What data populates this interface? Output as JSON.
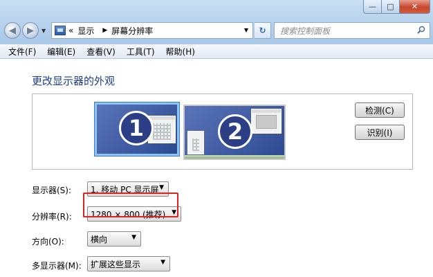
{
  "window": {
    "controls": {
      "minimize": "—",
      "maximize": "□",
      "close": "✕"
    }
  },
  "nav": {
    "back": "◀",
    "forward": "▶",
    "address": {
      "prefix": "«",
      "crumbs": [
        "显示",
        "屏幕分辨率"
      ],
      "separator": "▶"
    },
    "refresh": "↻",
    "search_placeholder": "搜索控制面板"
  },
  "menu": {
    "items": [
      "文件(F)",
      "编辑(E)",
      "查看(V)",
      "工具(T)",
      "帮助(H)"
    ]
  },
  "main": {
    "heading": "更改显示器的外观",
    "monitors": [
      {
        "number": "1",
        "selected": true
      },
      {
        "number": "2",
        "selected": false
      }
    ],
    "detect_button": "检测(C)",
    "identify_button": "识别(I)",
    "fields": {
      "display": {
        "label": "显示器(S):",
        "value": "1. 移动 PC 显示屏"
      },
      "resolution": {
        "label": "分辨率(R):",
        "value": "1280 × 800 (推荐)"
      },
      "orientation": {
        "label": "方向(O):",
        "value": "横向"
      },
      "multi_display": {
        "label": "多显示器(M):",
        "value": "扩展这些显示"
      }
    }
  },
  "colors": {
    "heading": "#1e3c8c",
    "highlight": "#e02020",
    "monitor_fill": "#3a569e"
  }
}
